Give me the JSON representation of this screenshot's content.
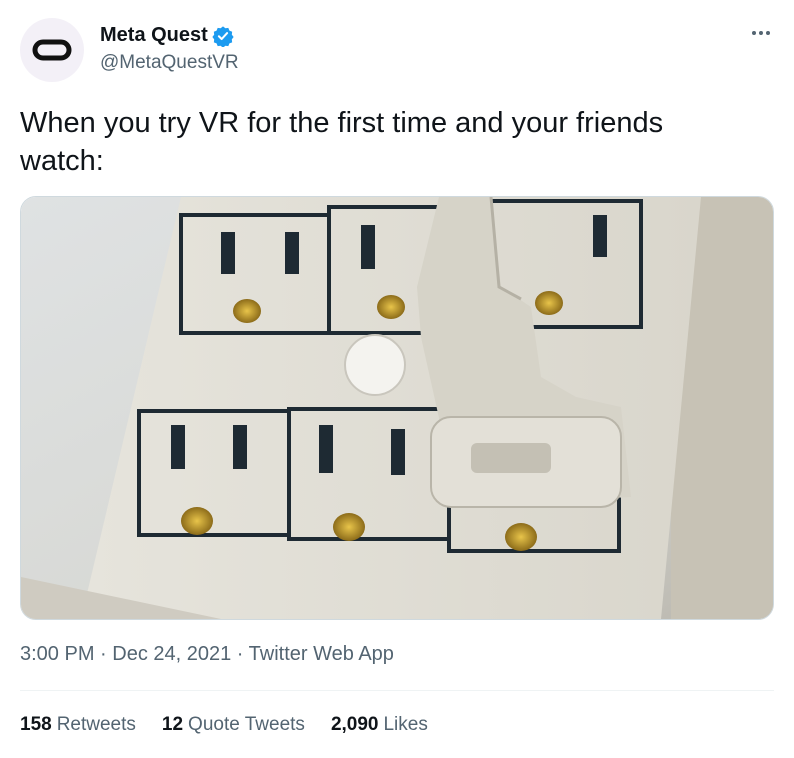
{
  "user": {
    "name": "Meta Quest",
    "handle": "@MetaQuestVR",
    "verified_color": "#1d9bf0"
  },
  "tweet": {
    "text": "When you try VR for the first time and your friends watch:",
    "time": "3:00 PM",
    "date": "Dec 24, 2021",
    "source": "Twitter Web App",
    "separator": " · "
  },
  "stats": {
    "retweets_count": "158",
    "retweets_label": "Retweets",
    "quotes_count": "12",
    "quotes_label": "Quote Tweets",
    "likes_count": "2,090",
    "likes_label": "Likes"
  },
  "icons": {
    "avatar": "meta-quest-logo",
    "verified": "verified-badge-icon",
    "more": "more-options-icon"
  }
}
